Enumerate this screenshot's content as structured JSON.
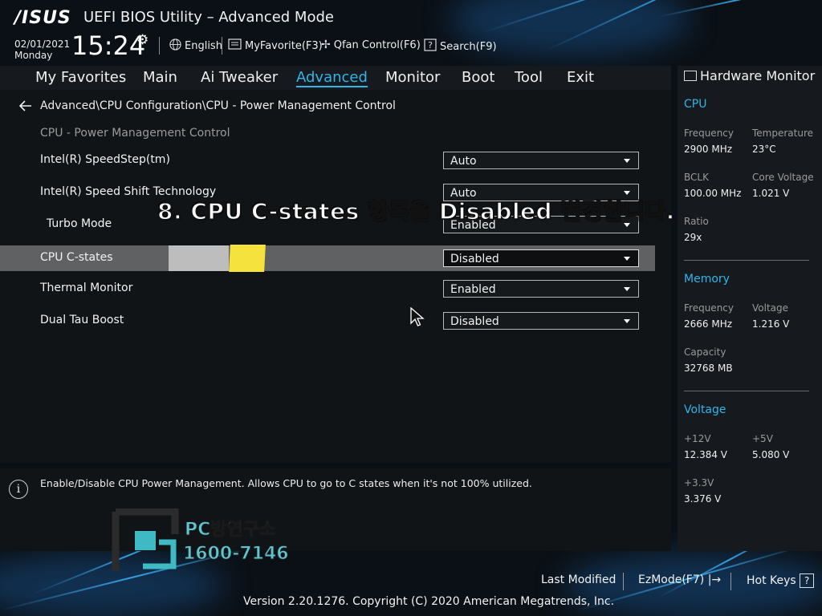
{
  "header": {
    "logo": "/ISUS",
    "title": "UEFI BIOS Utility – Advanced Mode",
    "date": "02/01/2021",
    "day": "Monday",
    "time": "15:24",
    "language": "English",
    "myfavorite": "MyFavorite(F3)",
    "qfan": "Qfan Control(F6)",
    "search": "Search(F9)"
  },
  "tabs": [
    "My Favorites",
    "Main",
    "Ai Tweaker",
    "Advanced",
    "Monitor",
    "Boot",
    "Tool",
    "Exit"
  ],
  "active_tab": "Advanced",
  "main": {
    "breadcrumb": "Advanced\\CPU Configuration\\CPU - Power Management Control",
    "section_title": "CPU - Power Management Control",
    "rows": [
      {
        "label": "Intel(R) SpeedStep(tm)",
        "value": "Auto"
      },
      {
        "label": "Intel(R) Speed Shift Technology",
        "value": "Auto"
      },
      {
        "label": "Turbo Mode",
        "value": "Enabled"
      },
      {
        "label": "CPU C-states",
        "value": "Disabled"
      },
      {
        "label": "Thermal Monitor",
        "value": "Enabled"
      },
      {
        "label": "Dual Tau Boost",
        "value": "Disabled"
      }
    ],
    "selected_row": "CPU C-states"
  },
  "caption": "8. CPU C-states 항목을 Disabled 변경합니다.",
  "help": {
    "text": "Enable/Disable CPU Power Management. Allows CPU to go to C states when it's not 100% utilized."
  },
  "watermark": {
    "name": "PC방연구소",
    "phone": "1600-7146"
  },
  "hardware_monitor": {
    "title": "Hardware Monitor",
    "cpu": {
      "title": "CPU",
      "frequency_label": "Frequency",
      "frequency": "2900 MHz",
      "temperature_label": "Temperature",
      "temperature": "23°C",
      "bclk_label": "BCLK",
      "bclk": "100.00 MHz",
      "core_voltage_label": "Core Voltage",
      "core_voltage": "1.021 V",
      "ratio_label": "Ratio",
      "ratio": "29x"
    },
    "memory": {
      "title": "Memory",
      "frequency_label": "Frequency",
      "frequency": "2666 MHz",
      "voltage_label": "Voltage",
      "voltage": "1.216 V",
      "capacity_label": "Capacity",
      "capacity": "32768 MB"
    },
    "voltage": {
      "title": "Voltage",
      "v12_label": "+12V",
      "v12": "12.384 V",
      "v5_label": "+5V",
      "v5": "5.080 V",
      "v33_label": "+3.3V",
      "v33": "3.376 V"
    }
  },
  "footer": {
    "last_modified": "Last Modified",
    "ezmode": "EzMode(F7)",
    "hotkeys": "Hot Keys",
    "copyright": "Version 2.20.1276. Copyright (C) 2020 American Megatrends, Inc."
  },
  "colors": {
    "accent": "#2fb6e8",
    "selected_row": "#5f6163",
    "highlight_yellow": "#f6e23d"
  }
}
